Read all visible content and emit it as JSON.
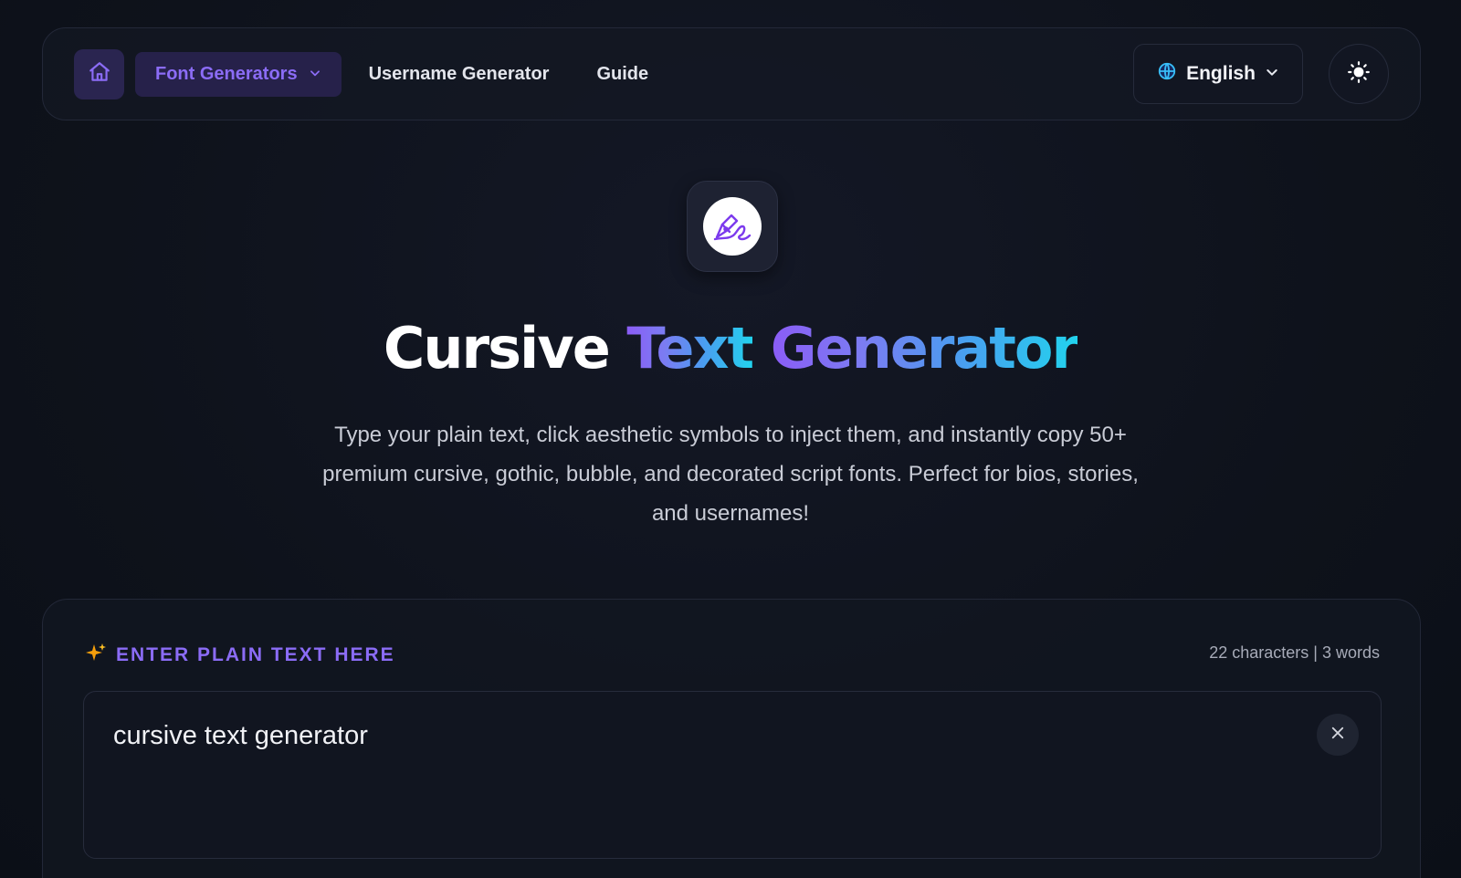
{
  "navbar": {
    "home_icon": "home-icon",
    "font_generators_label": "Font Generators",
    "username_generator_label": "Username Generator",
    "guide_label": "Guide",
    "language_label": "English",
    "theme_icon": "sun-icon"
  },
  "hero": {
    "logo_icon": "pen-signature-icon",
    "title_part1": "Cursive",
    "title_part2": "Text",
    "title_part3": "Generator",
    "subtitle": "Type your plain text, click aesthetic symbols to inject them, and instantly copy 50+ premium cursive, gothic, bubble, and decorated script fonts. Perfect for bios, stories, and usernames!"
  },
  "input_card": {
    "label": "ENTER PLAIN TEXT HERE",
    "label_icon": "sparkles-icon",
    "counter": "22 characters | 3 words",
    "text_value": "cursive text generator",
    "clear_icon": "close-icon"
  },
  "colors": {
    "accent_purple": "#8b6cf6",
    "accent_cyan": "#22d3ee",
    "background": "#0e121b"
  }
}
